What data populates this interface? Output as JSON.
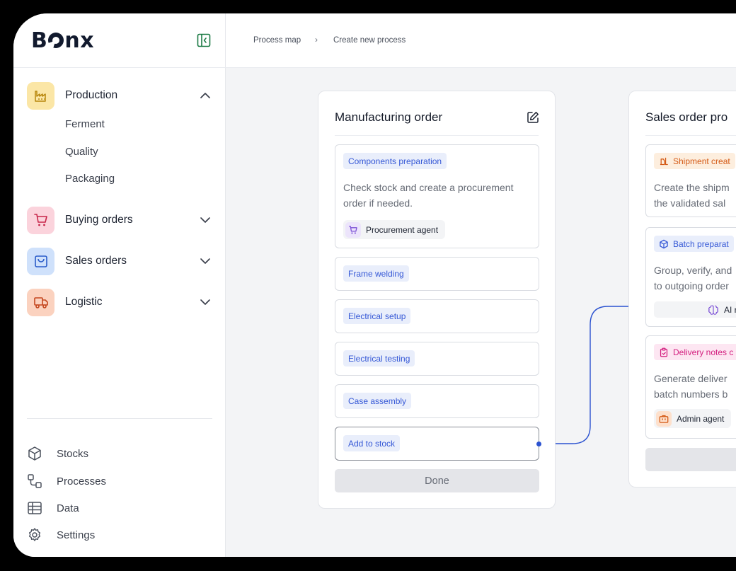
{
  "app": {
    "logo": "Bonx"
  },
  "breadcrumb": {
    "items": [
      "Process map",
      "Create new process"
    ],
    "separator": "›"
  },
  "sidebar": {
    "sections": [
      {
        "label": "Production",
        "icon": "factory-icon",
        "color": "#fbe6a6",
        "expanded": true,
        "children": [
          "Ferment",
          "Quality",
          "Packaging"
        ]
      },
      {
        "label": "Buying orders",
        "icon": "cart-icon",
        "color": "#fbd3dc",
        "expanded": false
      },
      {
        "label": "Sales orders",
        "icon": "bag-icon",
        "color": "#cfe1fb",
        "expanded": false
      },
      {
        "label": "Logistic",
        "icon": "truck-icon",
        "color": "#fbd2bf",
        "expanded": false
      }
    ],
    "bottom": [
      "Stocks",
      "Processes",
      "Data",
      "Settings"
    ]
  },
  "cards": {
    "manufacturing": {
      "title": "Manufacturing order",
      "steps": [
        {
          "tag": "Components preparation",
          "desc": "Check stock and create a procurement order if needed.",
          "agent": "Procurement agent"
        },
        {
          "tag": "Frame welding"
        },
        {
          "tag": "Electrical setup"
        },
        {
          "tag": "Electrical testing"
        },
        {
          "tag": "Case assembly"
        },
        {
          "tag": "Add to stock"
        }
      ],
      "done": "Done"
    },
    "sales": {
      "title": "Sales order pro",
      "steps": [
        {
          "tag": "Shipment creat",
          "desc_lines": [
            "Create the shipm",
            "the validated sal"
          ]
        },
        {
          "tag": "Batch preparat",
          "desc_lines": [
            "Group, verify, and",
            "to outgoing order"
          ],
          "agent": "AI r"
        },
        {
          "tag": "Delivery notes c",
          "desc_lines": [
            "Generate deliver",
            "batch numbers b"
          ],
          "agent": "Admin agent"
        }
      ]
    }
  },
  "colors": {
    "accent": "#2b52d0",
    "tag_bg": "#e9eefb",
    "tag_text": "#3558d6"
  }
}
